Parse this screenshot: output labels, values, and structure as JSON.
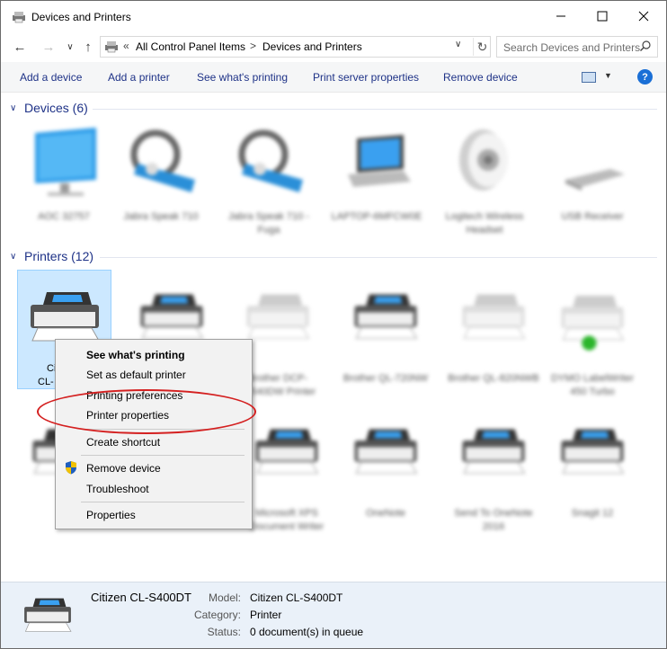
{
  "window": {
    "title": "Devices and Printers"
  },
  "address": {
    "crumbs": [
      "All Control Panel Items",
      "Devices and Printers"
    ],
    "prefix": "«",
    "separator": ">"
  },
  "search": {
    "placeholder": "Search Devices and Printers"
  },
  "commands": [
    "Add a device",
    "Add a printer",
    "See what's printing",
    "Print server properties",
    "Remove device"
  ],
  "groups": {
    "devices": {
      "title": "Devices (6)"
    },
    "printers": {
      "title": "Printers (12)"
    }
  },
  "devices": [
    {
      "label": "AOC 32757",
      "icon": "monitor-icon"
    },
    {
      "label": "Jabra Speak 710",
      "icon": "speakerphone-icon"
    },
    {
      "label": "Jabra Speak 710 - Fuga",
      "icon": "speakerphone-icon"
    },
    {
      "label": "LAPTOP-6MFCW0E",
      "icon": "laptop-icon"
    },
    {
      "label": "Logitech Wireless Headset",
      "icon": "speaker-icon"
    },
    {
      "label": "USB Receiver",
      "icon": "usb-icon"
    }
  ],
  "printers_row1": [
    {
      "label": "Citizen CL-S400DT",
      "icon": "printer-icon",
      "selected": true
    },
    {
      "label": "",
      "icon": "printer-icon"
    },
    {
      "label": "Brother DCP-L2540DW Printer",
      "icon": "printer-icon"
    },
    {
      "label": "Brother QL-720NW",
      "icon": "printer-icon"
    },
    {
      "label": "Brother QL-820NWB",
      "icon": "printer-icon"
    },
    {
      "label": "DYMO LabelWriter 450 Turbo",
      "icon": "printer-icon"
    }
  ],
  "printers_row2": [
    {
      "label": "",
      "icon": "printer-icon"
    },
    {
      "label": "Microsoft XPS Document Writer",
      "icon": "printer-icon"
    },
    {
      "label": "OneNote",
      "icon": "printer-icon"
    },
    {
      "label": "Send To OneNote 2016",
      "icon": "printer-icon"
    },
    {
      "label": "Snagit 12",
      "icon": "printer-icon"
    }
  ],
  "selected_label_fragments": [
    "Ci",
    "CL-"
  ],
  "context_menu": {
    "items": [
      {
        "label": "See what's printing",
        "bold": true
      },
      {
        "label": "Set as default printer"
      },
      {
        "label": "Printing preferences"
      },
      {
        "label": "Printer properties",
        "highlighted": true
      },
      {
        "label": "Create shortcut"
      },
      {
        "label": "Remove device",
        "icon": "uac-shield-icon"
      },
      {
        "label": "Troubleshoot"
      },
      {
        "label": "Properties"
      }
    ]
  },
  "details": {
    "name": "Citizen CL-S400DT",
    "model_label": "Model:",
    "model": "Citizen CL-S400DT",
    "category_label": "Category:",
    "category": "Printer",
    "status_label": "Status:",
    "status": "0 document(s) in queue"
  },
  "colors": {
    "accent": "#1e3287",
    "selection": "#cce8ff",
    "annotation": "#d42020",
    "details_bg": "#eaf1f9"
  }
}
